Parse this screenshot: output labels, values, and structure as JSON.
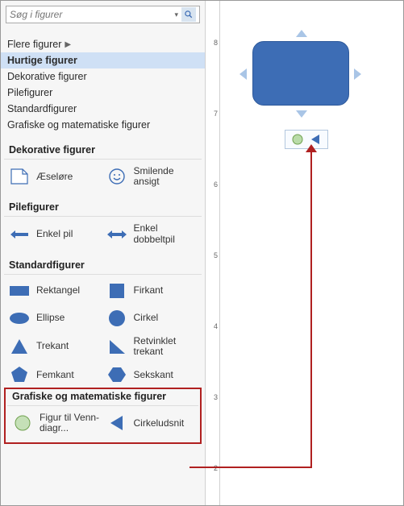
{
  "search": {
    "placeholder": "Søg i figurer"
  },
  "categories": {
    "more": "Flere figurer",
    "items": [
      "Hurtige figurer",
      "Dekorative figurer",
      "Pilefigurer",
      "Standardfigurer",
      "Grafiske og matematiske figurer"
    ],
    "selected": "Hurtige figurer"
  },
  "sections": {
    "decorative": {
      "title": "Dekorative figurer",
      "items": [
        {
          "id": "dog-ear",
          "label": "Æseløre"
        },
        {
          "id": "smiley",
          "label": "Smilende ansigt"
        }
      ]
    },
    "arrows": {
      "title": "Pilefigurer",
      "items": [
        {
          "id": "simple-arrow",
          "label": "Enkel pil"
        },
        {
          "id": "double-arrow",
          "label": "Enkel dobbeltpil"
        }
      ]
    },
    "standard": {
      "title": "Standardfigurer",
      "items": [
        {
          "id": "rectangle",
          "label": "Rektangel"
        },
        {
          "id": "square",
          "label": "Firkant"
        },
        {
          "id": "ellipse",
          "label": "Ellipse"
        },
        {
          "id": "circle",
          "label": "Cirkel"
        },
        {
          "id": "triangle",
          "label": "Trekant"
        },
        {
          "id": "right-triangle",
          "label": "Retvinklet trekant"
        },
        {
          "id": "pentagon",
          "label": "Femkant"
        },
        {
          "id": "hexagon",
          "label": "Sekskant"
        }
      ]
    },
    "math": {
      "title": "Grafiske og matematiske figurer",
      "items": [
        {
          "id": "venn",
          "label": "Figur til Venn-diagr..."
        },
        {
          "id": "pie-slice",
          "label": "Cirkeludsnit"
        }
      ]
    }
  },
  "ruler_ticks": [
    "8",
    "7",
    "6",
    "5",
    "4",
    "3",
    "2"
  ],
  "colors": {
    "shape_fill": "#3d6db5",
    "shape_stroke": "#2f5a9b",
    "venn_fill": "#b9dba8",
    "highlight": "#b02020"
  }
}
